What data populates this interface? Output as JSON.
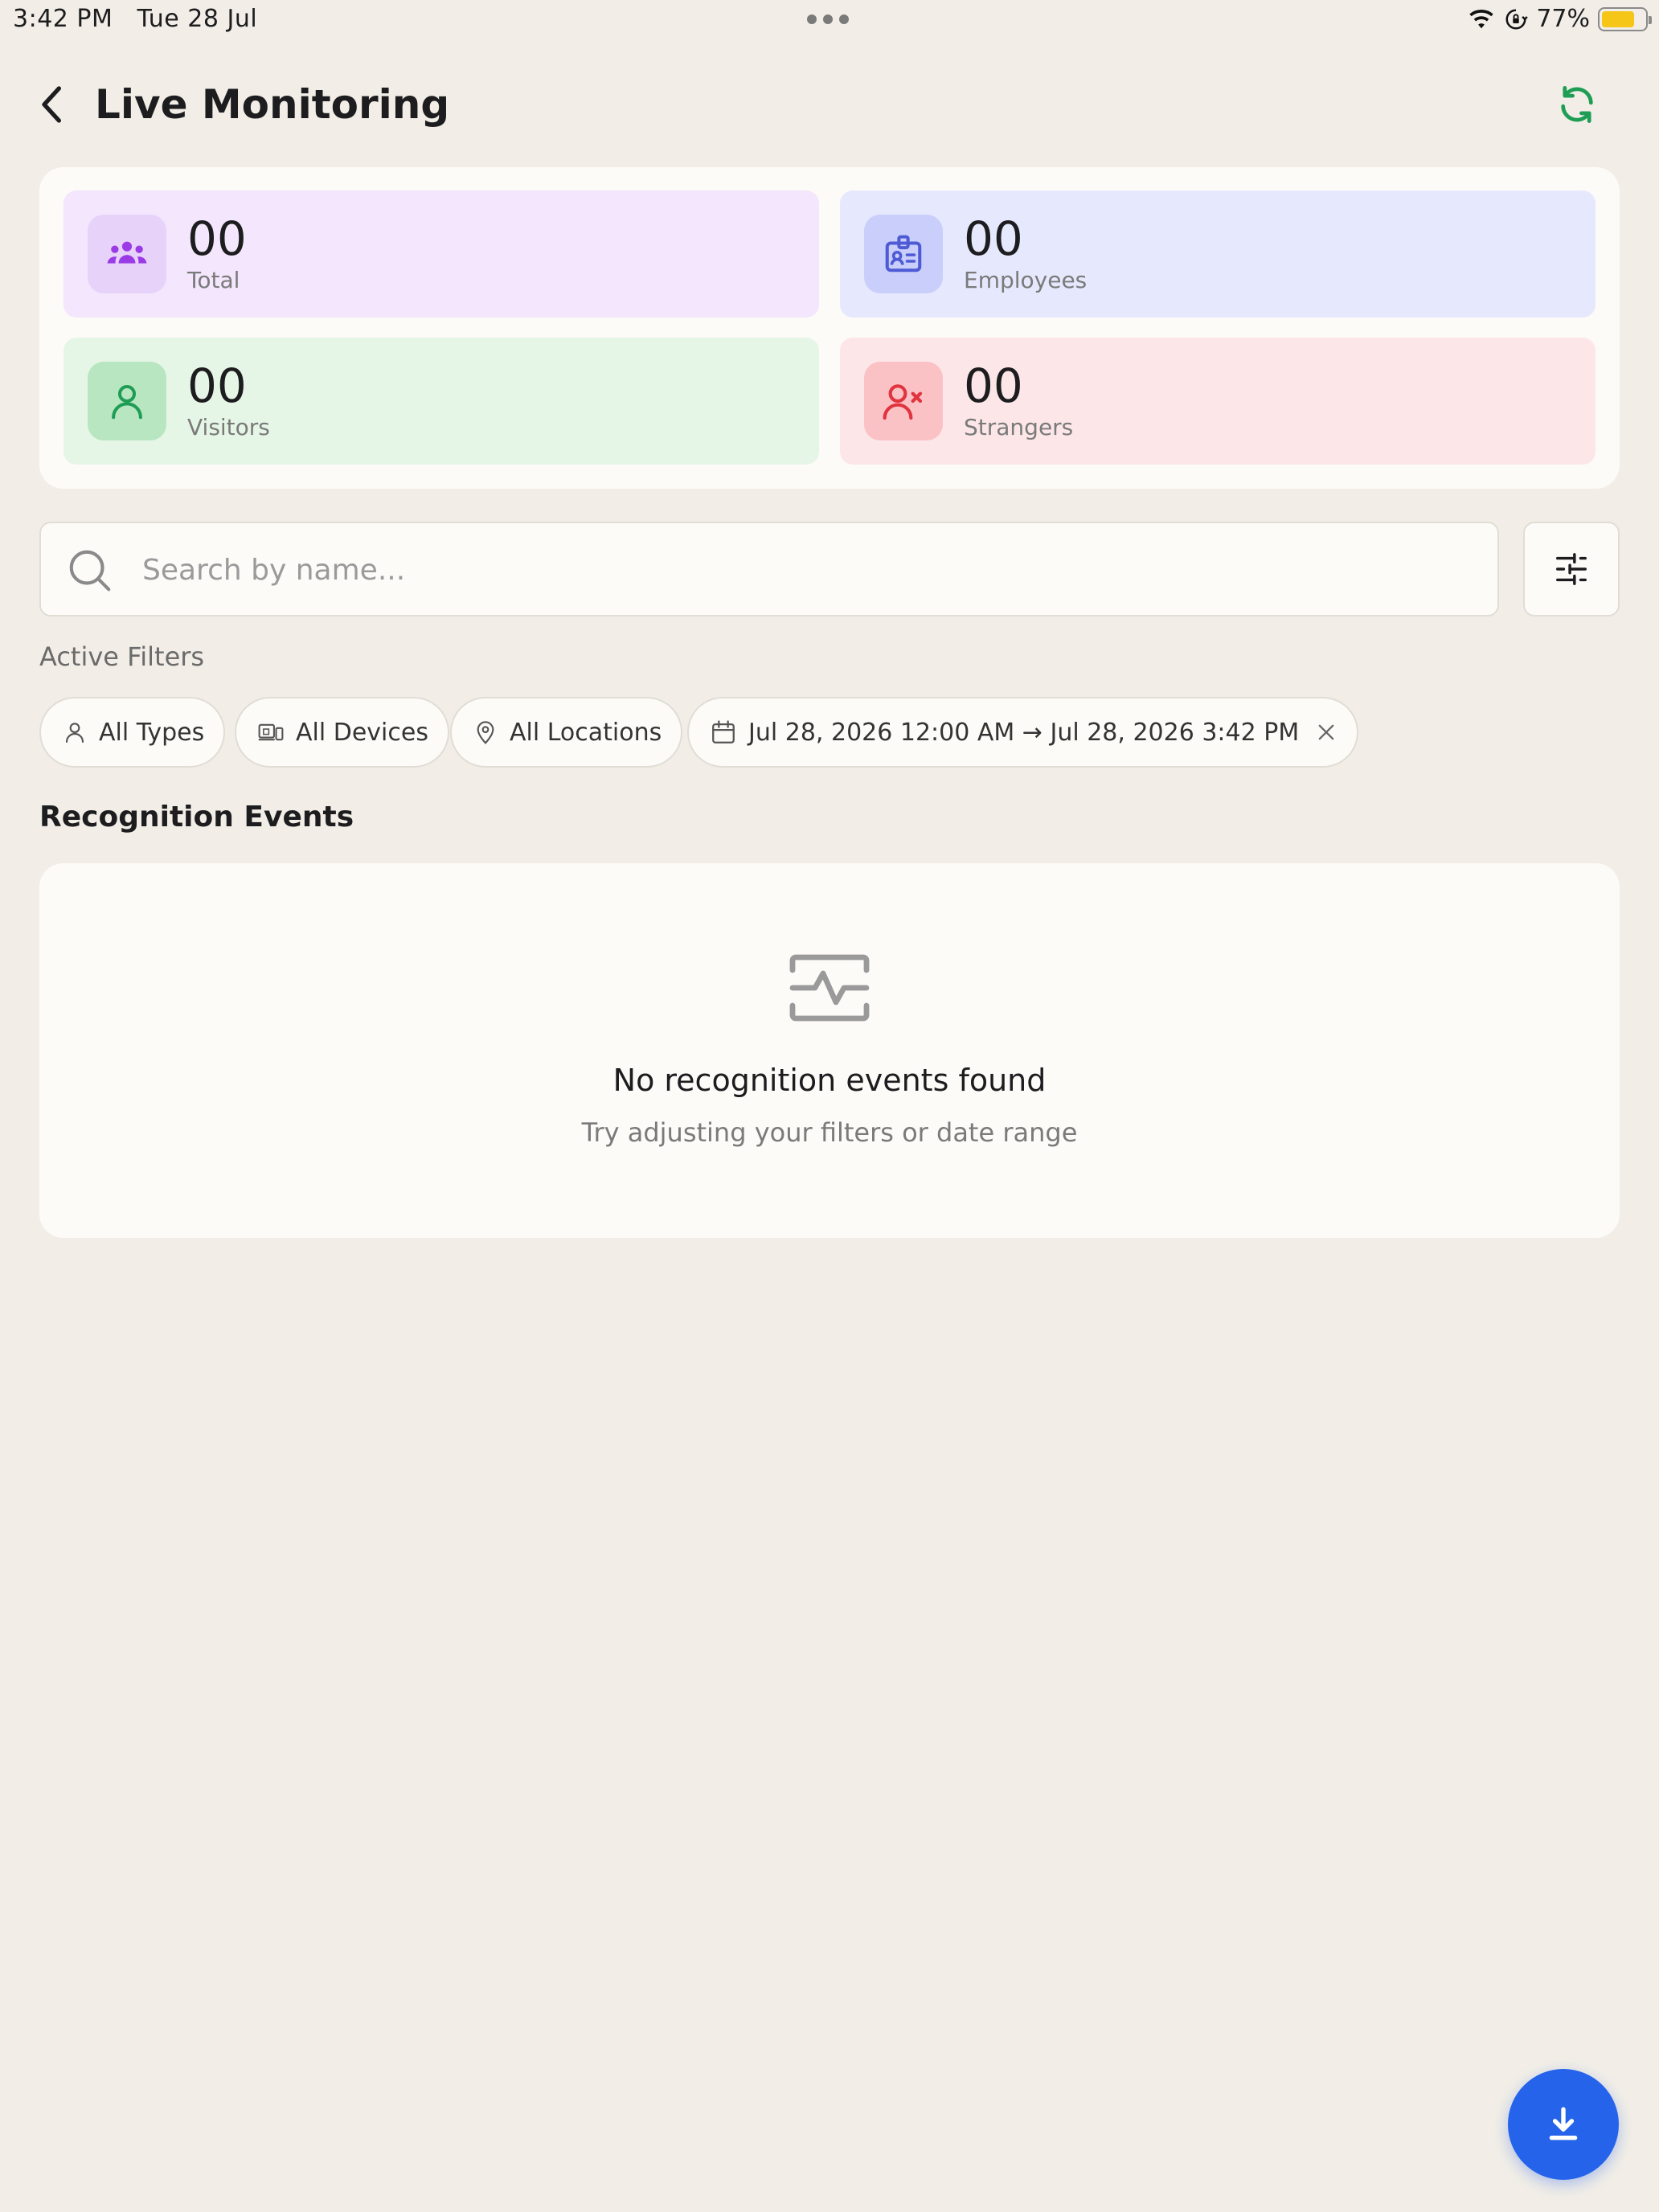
{
  "status_bar": {
    "time": "3:42 PM",
    "date": "Tue 28 Jul",
    "battery": "77%",
    "battery_level": 0.77,
    "icons": [
      "wifi-icon",
      "orientation-lock-icon",
      "battery-icon"
    ]
  },
  "header": {
    "title": "Live Monitoring",
    "back_icon": "chevron-left-icon",
    "refresh_icon": "refresh-icon"
  },
  "stats": {
    "total": {
      "value": "00",
      "label": "Total",
      "icon": "group-icon",
      "bg": "#f3e6fd",
      "icon_bg": "#e7d3fa",
      "icon_color": "#9b3be6"
    },
    "employees": {
      "value": "00",
      "label": "Employees",
      "icon": "id-badge-icon",
      "bg": "#e6e9fd",
      "icon_bg": "#c9cffa",
      "icon_color": "#4f5bd5"
    },
    "visitors": {
      "value": "00",
      "label": "Visitors",
      "icon": "user-icon",
      "bg": "#e6f6e6",
      "icon_bg": "#b8e6c0",
      "icon_color": "#1f9d55"
    },
    "strangers": {
      "value": "00",
      "label": "Strangers",
      "icon": "user-x-icon",
      "bg": "#fde6e8",
      "icon_bg": "#fbc2c6",
      "icon_color": "#e0343f"
    }
  },
  "search": {
    "placeholder": "Search by name...",
    "value": "",
    "icon": "search-icon",
    "filter_icon": "sliders-icon"
  },
  "active_filters": {
    "label": "Active Filters",
    "chips": [
      {
        "label": "All Types",
        "icon": "user-icon"
      },
      {
        "label": "All Devices",
        "icon": "devices-icon"
      },
      {
        "label": "All Locations",
        "icon": "map-pin-icon"
      },
      {
        "label": "Jul 28, 2026 12:00 AM → Jul 28, 2026 3:42 PM",
        "icon": "calendar-icon",
        "close_icon": "close-icon"
      }
    ]
  },
  "events": {
    "title": "Recognition Events",
    "empty_icon": "activity-icon",
    "empty_title": "No recognition events found",
    "empty_subtitle": "Try adjusting your filters or date range"
  },
  "fab": {
    "icon": "download-icon",
    "color": "#2563eb"
  },
  "colors": {
    "background": "#f2eee7",
    "card": "#fcfbf8",
    "accent_green": "#1f9d55"
  }
}
